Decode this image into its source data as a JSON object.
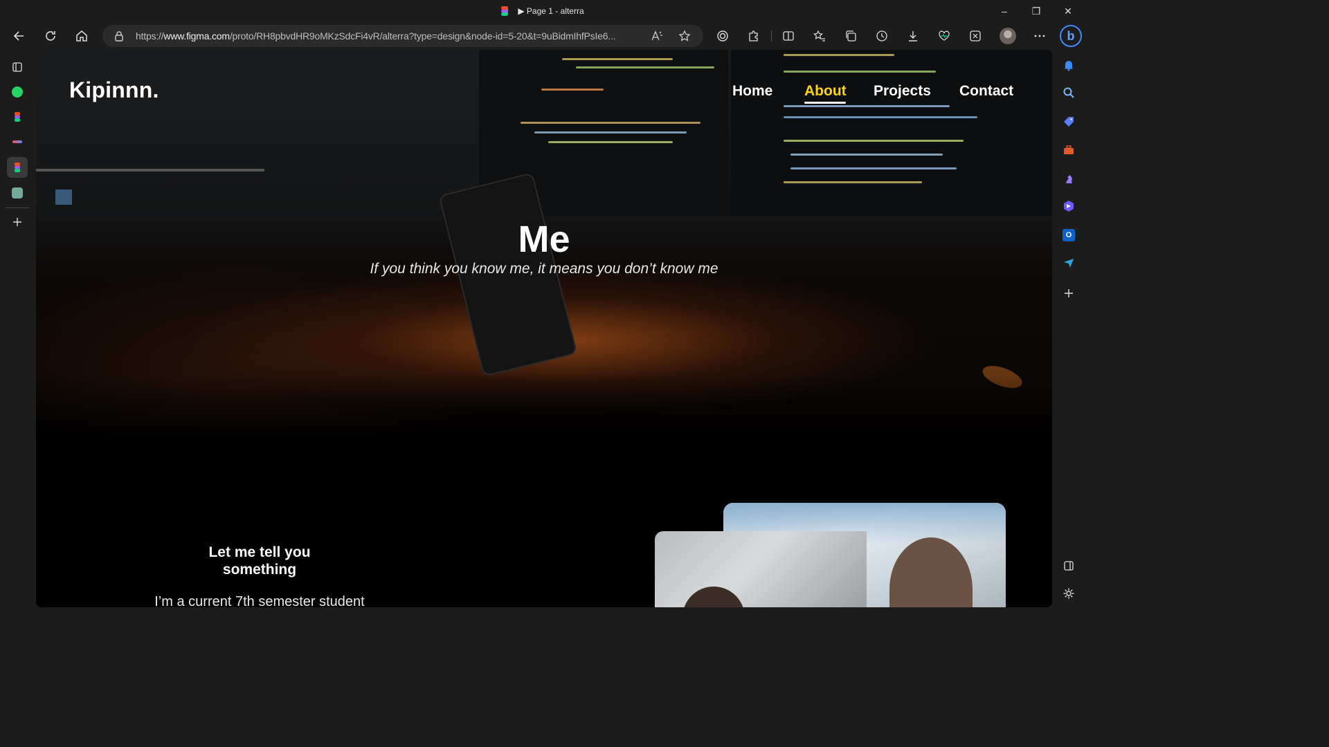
{
  "window": {
    "title": "▶ Page 1 - alterra",
    "minimize": "–",
    "restore": "❐",
    "close": "✕"
  },
  "browser": {
    "url_prefix": "https://",
    "url_host": "www.figma.com",
    "url_path": "/proto/RH8pbvdHR9oMKzSdcFi4vR/alterra?type=design&node-id=5-20&t=9uBidmIhfPsIe6..."
  },
  "page": {
    "logo": "Kipinnn.",
    "nav": [
      {
        "label": "Home",
        "active": false
      },
      {
        "label": "About",
        "active": true
      },
      {
        "label": "Projects",
        "active": false
      },
      {
        "label": "Contact",
        "active": false
      }
    ],
    "hero_title": "Me",
    "hero_subtitle": "If you think you know me, it means you don’t know me",
    "section_heading": "Let me tell you something",
    "section_text": "I’m a current 7th semester student"
  },
  "colors": {
    "accent": "#ffd500",
    "page_bg": "#000000",
    "chrome_bg": "#1c1c1c"
  },
  "icons": {
    "left_sidebar": [
      "tabs-icon",
      "whatsapp-icon",
      "figma-icon",
      "app-icon",
      "figma-active-icon",
      "chatgpt-icon",
      "add-icon"
    ],
    "right_sidebar": [
      "bell-icon",
      "search-icon",
      "tag-icon",
      "toolbox-icon",
      "chess-icon",
      "copilot-icon",
      "outlook-icon",
      "send-icon",
      "add-icon",
      "sidebar-toggle-icon",
      "settings-icon"
    ]
  }
}
